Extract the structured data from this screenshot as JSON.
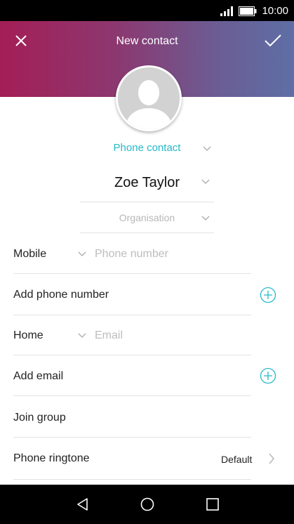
{
  "status": {
    "time": "10:00"
  },
  "header": {
    "title": "New contact"
  },
  "contact": {
    "account": "Phone contact",
    "name": "Zoe Taylor",
    "organisation_placeholder": "Organisation"
  },
  "phone": {
    "type": "Mobile",
    "placeholder": "Phone number",
    "add_label": "Add phone number"
  },
  "email": {
    "type": "Home",
    "placeholder": "Email",
    "add_label": "Add email"
  },
  "group": {
    "label": "Join group"
  },
  "ringtone": {
    "label": "Phone ringtone",
    "value": "Default"
  },
  "colors": {
    "accent": "#25b9c8",
    "header_start": "#a41e56",
    "header_end": "#5f6ea6"
  }
}
